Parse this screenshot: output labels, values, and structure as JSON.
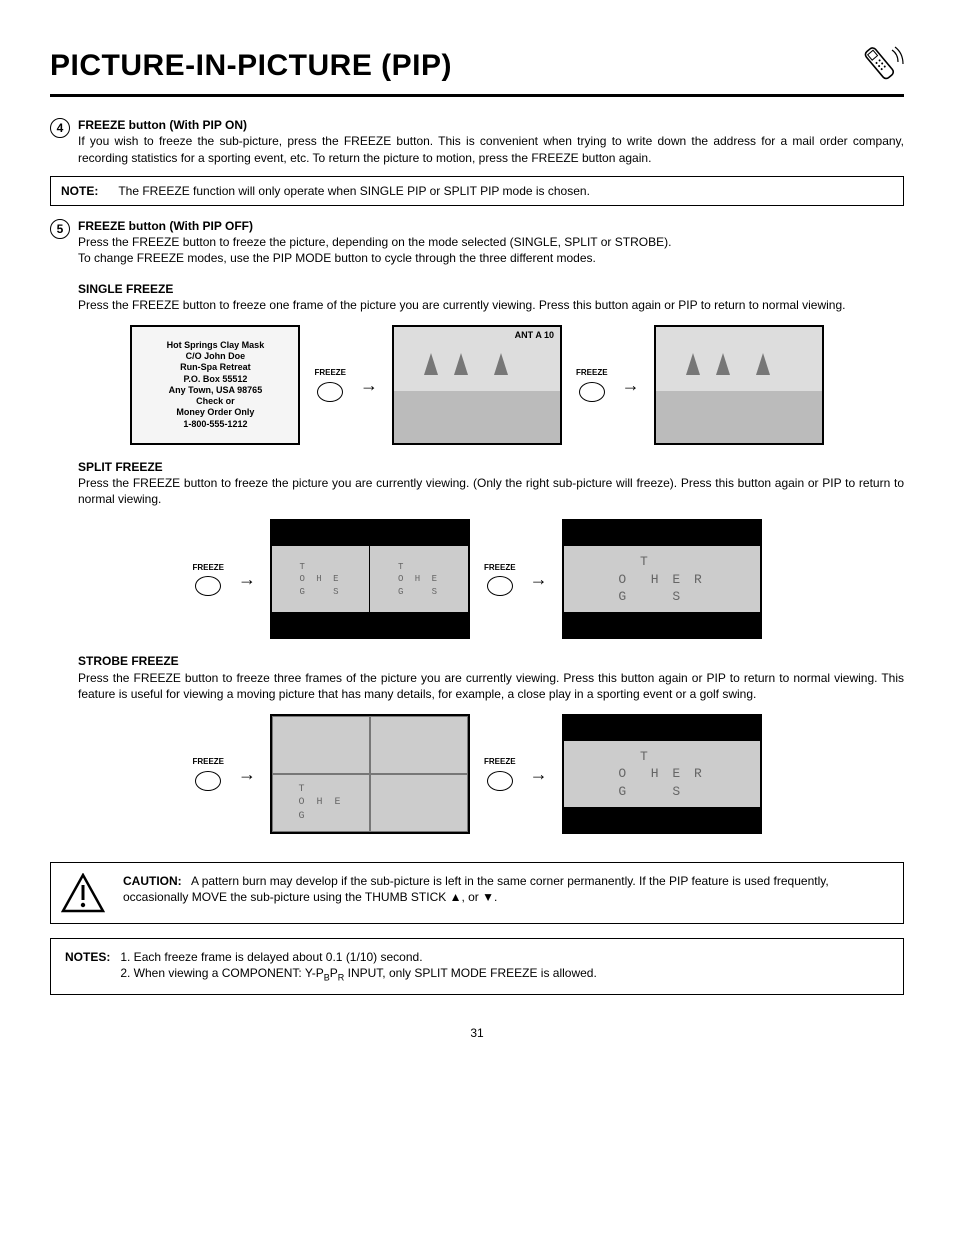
{
  "header": {
    "title": "PICTURE-IN-PICTURE (PIP)"
  },
  "item4": {
    "num": "4",
    "title": "FREEZE button (With PIP ON)",
    "text": "If you wish to freeze the sub-picture, press the FREEZE button. This is convenient when trying to write down the address for a mail order company, recording statistics for a sporting event, etc.  To return the picture to motion, press the FREEZE button again."
  },
  "note1": {
    "label": "NOTE:",
    "text": "The FREEZE function will only operate when SINGLE PIP or SPLIT PIP mode is chosen."
  },
  "item5": {
    "num": "5",
    "title": "FREEZE button (With PIP OFF)",
    "line1": "Press the FREEZE button to freeze the picture, depending on the mode selected (SINGLE, SPLIT or STROBE).",
    "line2": "To change FREEZE modes, use the PIP MODE button to cycle through the three different modes."
  },
  "single": {
    "title": "SINGLE FREEZE",
    "text": "Press the FREEZE button to freeze one frame of the picture you are currently viewing.  Press this button again or PIP to return to normal viewing.",
    "antLabel": "ANT A 10",
    "mail1": "Hot Springs Clay Mask",
    "mail2": "C/O John Doe",
    "mail3": "Run-Spa Retreat",
    "mail4": "P.O. Box 55512",
    "mail5": "Any Town, USA 98765",
    "mail6": "Check or",
    "mail7": "Money Order Only",
    "mail8": "1-800-555-1212"
  },
  "split": {
    "title": "SPLIT FREEZE",
    "text": "Press the FREEZE button to freeze the picture you are currently viewing.  (Only the right sub-picture will freeze). Press this button again or PIP to return to normal viewing."
  },
  "strobe": {
    "title": "STROBE FREEZE",
    "text": "Press the FREEZE button to freeze three frames of the picture you are currently viewing. Press this button again or PIP to return to normal viewing. This feature is useful for viewing a moving picture that has many details, for example, a close play in a sporting event or a golf swing."
  },
  "freezeLabel": "FREEZE",
  "caution": {
    "label": "CAUTION:",
    "text": "A pattern burn may develop if the sub-picture is left in the same corner permanently.  If the PIP feature is used frequently, occasionally MOVE the sub-picture using the THUMB STICK ▲, or ▼."
  },
  "notes": {
    "label": "NOTES:",
    "n1": "1.  Each freeze frame is delayed about 0.1 (1/10) second.",
    "n2a": "2.  When viewing a COMPONENT: Y-P",
    "n2b": "P",
    "n2c": " INPUT, only SPLIT MODE FREEZE is allowed.",
    "subB": "B",
    "subR": "R"
  },
  "pageNumber": "31"
}
